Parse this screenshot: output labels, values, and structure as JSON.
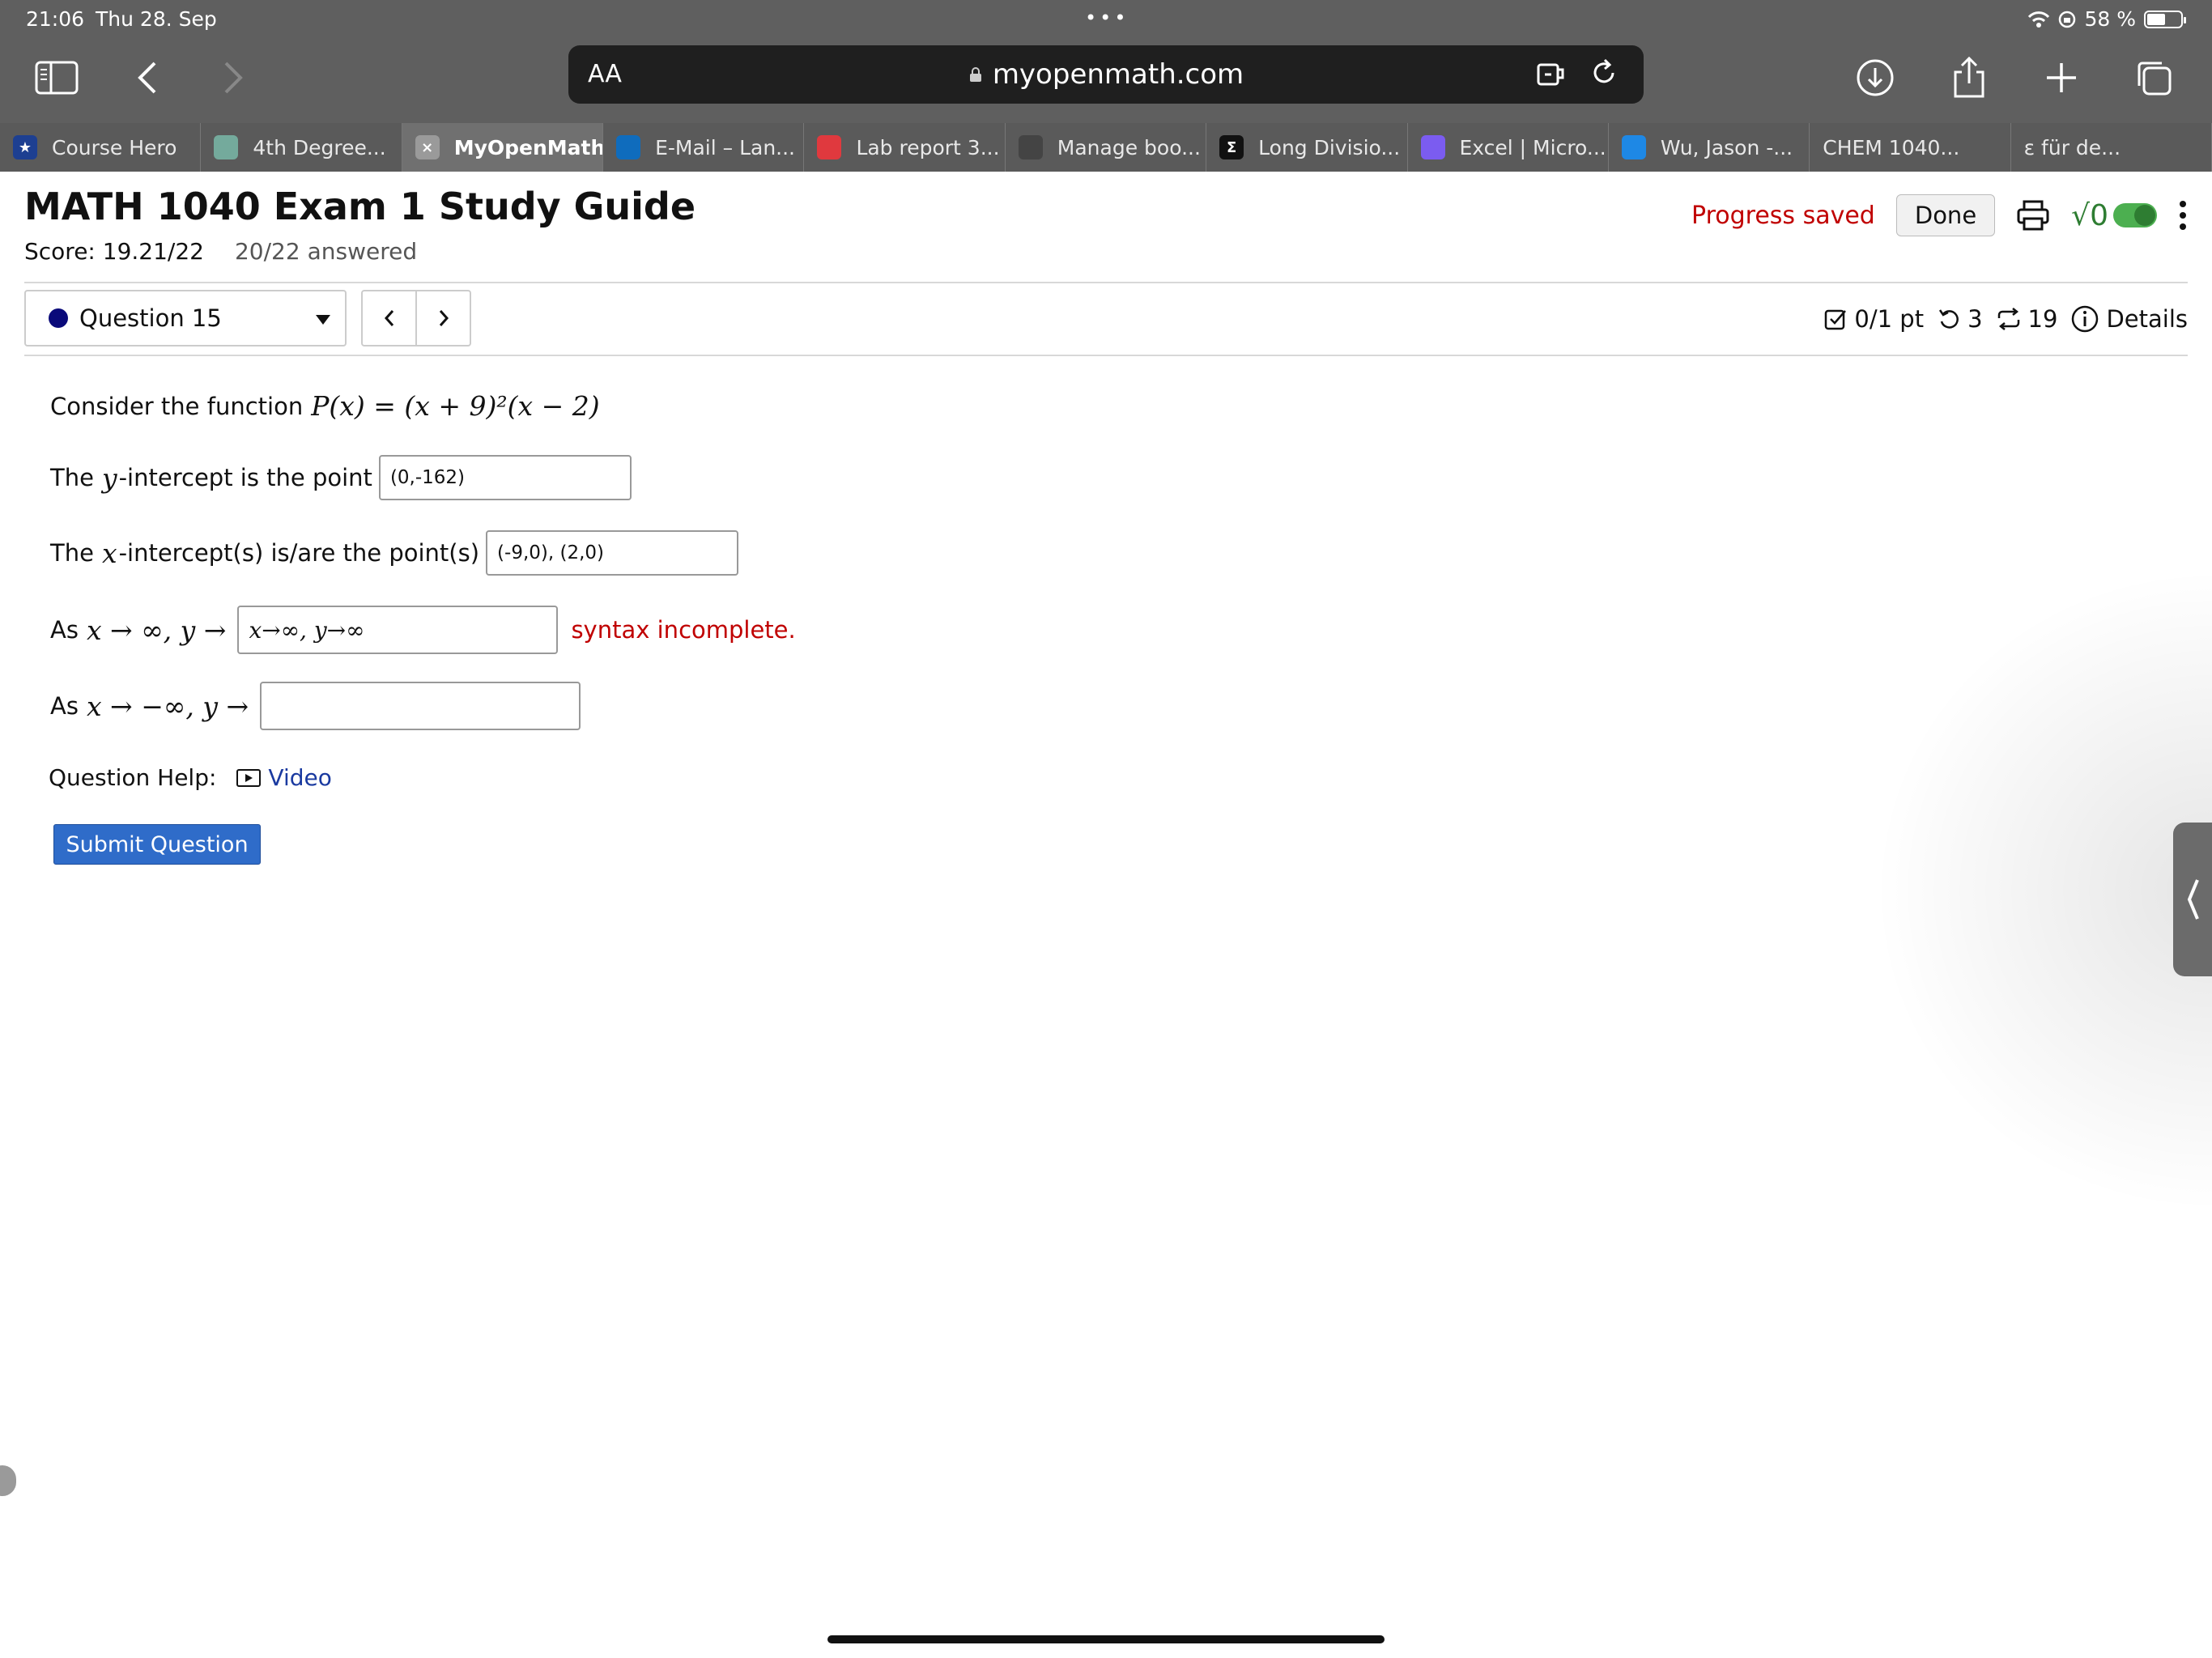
{
  "status_bar": {
    "time": "21:06",
    "date": "Thu 28. Sep",
    "battery": "58 %",
    "battery_level": 0.58
  },
  "browser": {
    "aa_label": "AA",
    "url": "myopenmath.com",
    "tabs": [
      {
        "label": "Course Hero",
        "icon": "course-hero-icon",
        "color": "#1d3f91"
      },
      {
        "label": "4th Degree...",
        "icon": "chatgpt-icon",
        "color": "#74aa9c"
      },
      {
        "label": "MyOpenMath",
        "icon": "close-icon",
        "color": "#9a9a9a",
        "active": true
      },
      {
        "label": "E-Mail – Lan...",
        "icon": "outlook-icon",
        "color": "#0f6cbd"
      },
      {
        "label": "Lab report 3...",
        "icon": "canvas-icon",
        "color": "#e0393e"
      },
      {
        "label": "Manage boo...",
        "icon": "booking-icon",
        "color": "#444444"
      },
      {
        "label": "Long Divisio...",
        "icon": "sigma-icon",
        "color": "#111111"
      },
      {
        "label": "Excel | Micro...",
        "icon": "copilot-icon",
        "color": "#7b5cf0"
      },
      {
        "label": "Wu, Jason -...",
        "icon": "onedrive-icon",
        "color": "#1e88e5"
      },
      {
        "label": "CHEM 1040...",
        "icon": "",
        "color": ""
      },
      {
        "label": "ε für de...",
        "icon": "",
        "color": ""
      }
    ]
  },
  "page": {
    "title": "MATH 1040 Exam 1 Study Guide",
    "score": "Score: 19.21/22",
    "answered": "20/22 answered",
    "progress_saved": "Progress saved",
    "done_label": "Done",
    "sqrt_label": "√0"
  },
  "question": {
    "selector_label": "Question 15",
    "points": "0/1 pt",
    "retries": "3",
    "attempts": "19",
    "details_label": "Details",
    "prompt_text": "Consider the function",
    "prompt_math": "P(x) = (x + 9)²(x − 2)",
    "y_intercept_label_pre": "The",
    "y_var": "y",
    "y_intercept_label_post": "-intercept is the point",
    "y_intercept_value": "(0,-162)",
    "x_intercept_label_pre": "The",
    "x_var": "x",
    "x_intercept_label_post": "-intercept(s) is/are the point(s)",
    "x_intercept_value": "(-9,0), (2,0)",
    "as_label": "As",
    "limit_pos_math": "x → ∞, y →",
    "limit_pos_value": "x→∞, y→∞",
    "syntax_msg": "syntax incomplete.",
    "limit_neg_math": "x → −∞, y →",
    "limit_neg_value": "",
    "help_label": "Question Help:",
    "video_label": "Video",
    "submit_label": "Submit Question"
  },
  "colors": {
    "accent": "#2f6cc9",
    "error": "#c00000",
    "chrome": "#5f5f5f"
  }
}
